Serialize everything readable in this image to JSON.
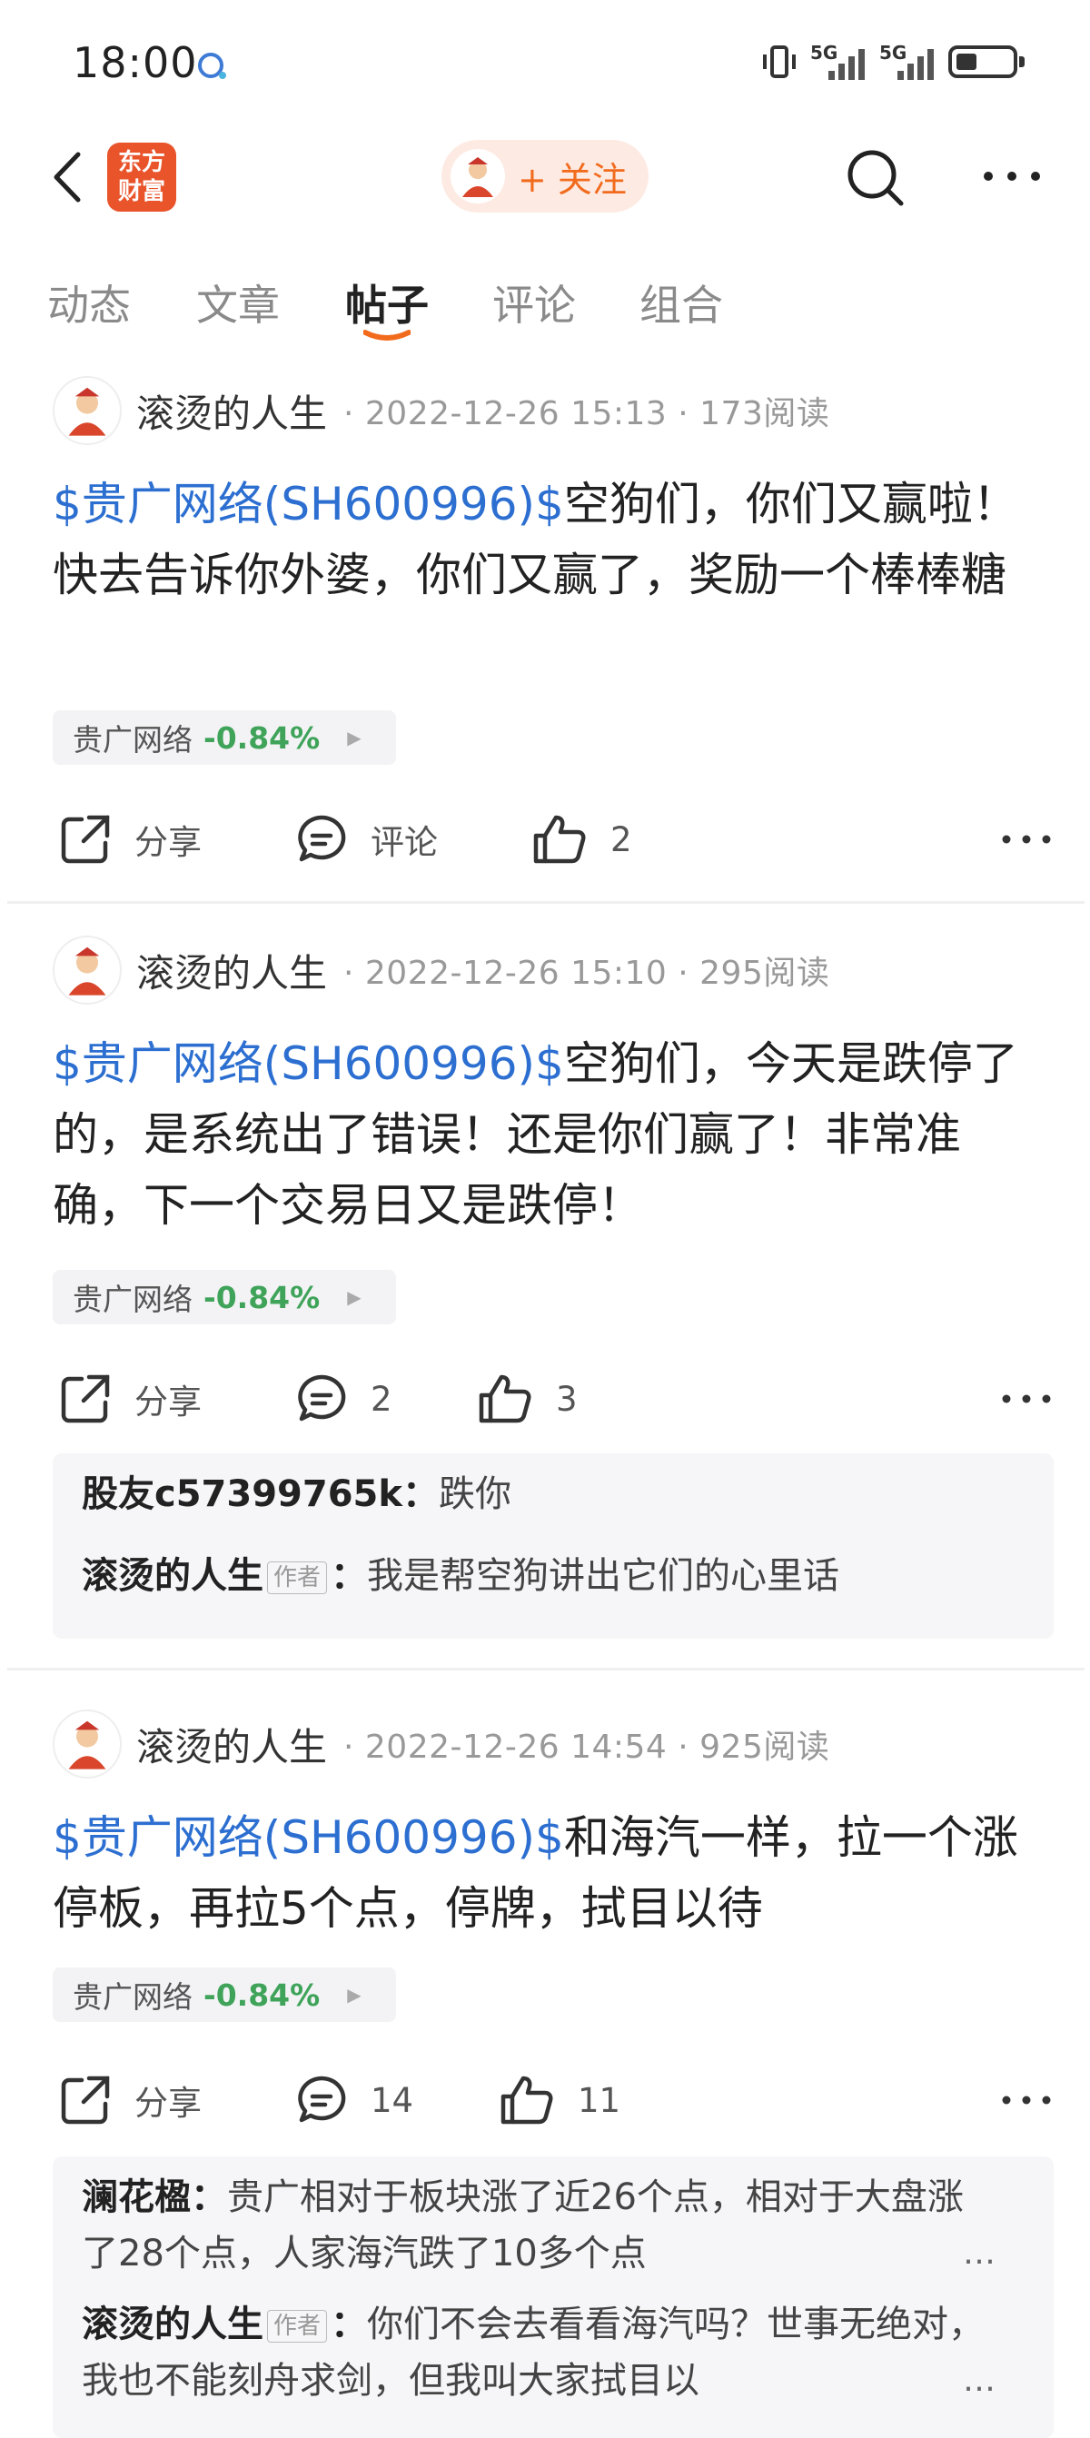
{
  "status_bar": {
    "time": "18:00",
    "network_1": "5G",
    "network_2": "5G"
  },
  "header": {
    "logo_line1": "东方",
    "logo_line2": "财富",
    "follow_label": "+ 关注"
  },
  "tabs": [
    {
      "label": "动态",
      "active": false
    },
    {
      "label": "文章",
      "active": false
    },
    {
      "label": "帖子",
      "active": true
    },
    {
      "label": "评论",
      "active": false
    },
    {
      "label": "组合",
      "active": false
    }
  ],
  "actions": {
    "share_label": "分享",
    "comment_label": "评论"
  },
  "posts": [
    {
      "author": "滚烫的人生",
      "datetime": "2022-12-26 15:13",
      "reads": "173阅读",
      "stock_tag": "$贵广网络(SH600996)$",
      "text": "空狗们，你们又赢啦！快去告诉你外婆，你们又赢了，奖励一个棒棒糖",
      "chip_name": "贵广网络",
      "chip_pct": "-0.84%",
      "comment_count": "评论",
      "like_count": "2",
      "comments": []
    },
    {
      "author": "滚烫的人生",
      "datetime": "2022-12-26 15:10",
      "reads": "295阅读",
      "stock_tag": "$贵广网络(SH600996)$",
      "text": "空狗们，今天是跌停了的，是系统出了错误！还是你们赢了！非常准确，下一个交易日又是跌停！",
      "chip_name": "贵广网络",
      "chip_pct": "-0.84%",
      "comment_count": "2",
      "like_count": "3",
      "comments": [
        {
          "who": "股友c57399765k",
          "is_author": false,
          "text": "跌你"
        },
        {
          "who": "滚烫的人生",
          "is_author": true,
          "author_tag": "作者",
          "text": "我是帮空狗讲出它们的心里话"
        }
      ]
    },
    {
      "author": "滚烫的人生",
      "datetime": "2022-12-26 14:54",
      "reads": "925阅读",
      "stock_tag": "$贵广网络(SH600996)$",
      "text": "和海汽一样，拉一个涨停板，再拉5个点，停牌，拭目以待",
      "chip_name": "贵广网络",
      "chip_pct": "-0.84%",
      "comment_count": "14",
      "like_count": "11",
      "comments": [
        {
          "who": "澜花楹",
          "is_author": false,
          "text": "贵广相对于板块涨了近26个点，相对于大盘涨了28个点，人家海汽跌了10多个点"
        },
        {
          "who": "滚烫的人生",
          "is_author": true,
          "author_tag": "作者",
          "text": "你们不会去看看海汽吗？世事无绝对，我也不能刻舟求剑，但我叫大家拭目以"
        }
      ]
    }
  ],
  "colors": {
    "brand": "#e9542b",
    "follow": "#f26b1d",
    "stock_link": "#2c6fd1",
    "change_down": "#3fa35a"
  },
  "icons": [
    "back-arrow-icon",
    "search-icon",
    "more-icon",
    "share-icon",
    "comment-icon",
    "like-icon",
    "avatar-icon"
  ]
}
